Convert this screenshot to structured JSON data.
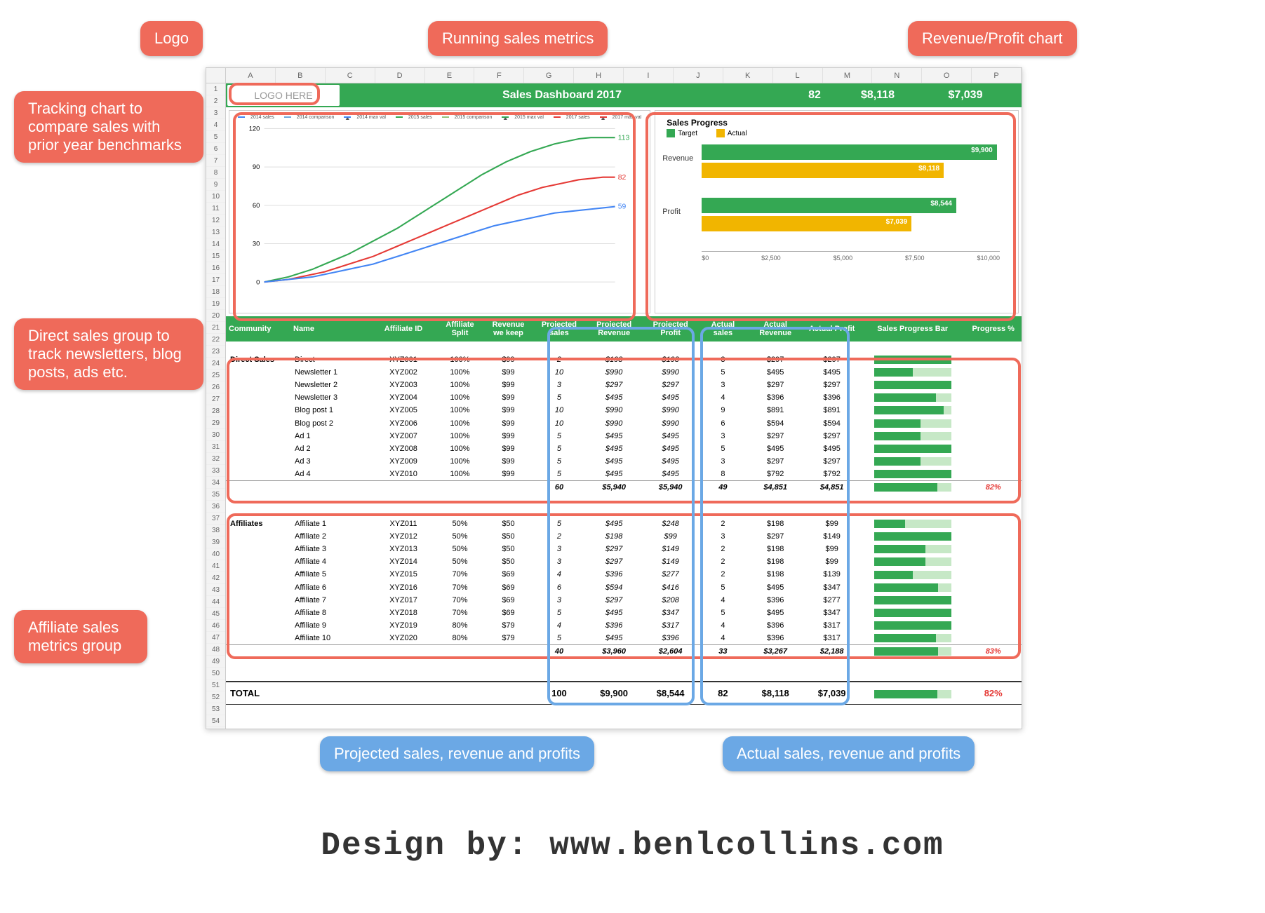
{
  "callouts": {
    "logo": "Logo",
    "running": "Running sales metrics",
    "revprofit": "Revenue/Profit chart",
    "tracking": "Tracking chart to compare sales with prior year benchmarks",
    "directgroup": "Direct sales  group to track newsletters, blog posts, ads etc.",
    "affgroup": "Affiliate sales metrics group",
    "projected": "Projected sales, revenue and profits",
    "actual": "Actual sales, revenue and profits"
  },
  "columns": [
    "A",
    "B",
    "C",
    "D",
    "E",
    "F",
    "G",
    "H",
    "I",
    "J",
    "K",
    "L",
    "M",
    "N",
    "O",
    "P"
  ],
  "row_numbers": [
    "1",
    "2",
    "3",
    "4",
    "5",
    "6",
    "7",
    "8",
    "9",
    "10",
    "11",
    "12",
    "13",
    "14",
    "15",
    "16",
    "17",
    "18",
    "19",
    "20",
    "21",
    "22",
    "23",
    "24",
    "25",
    "26",
    "27",
    "28",
    "29",
    "30",
    "31",
    "32",
    "33",
    "34",
    "35",
    "36",
    "37",
    "38",
    "39",
    "40",
    "41",
    "42",
    "43",
    "44",
    "45",
    "46",
    "47",
    "48",
    "49",
    "50",
    "51",
    "52",
    "53",
    "54"
  ],
  "title": {
    "logo": "LOGO HERE",
    "heading": "Sales Dashboard 2017",
    "metric1": "82",
    "metric2": "$8,118",
    "metric3": "$7,039"
  },
  "chart_data": [
    {
      "type": "line",
      "title": "",
      "ylim": [
        0,
        120
      ],
      "series_legend": [
        "2014 sales",
        "2014 comparison",
        "2014 max val",
        "2015 sales",
        "2015 comparison",
        "2015 max val",
        "2017 sales",
        "2017 max val"
      ],
      "end_labels": {
        "green": "113",
        "red": "82",
        "blue": "59"
      },
      "x": [
        0,
        2,
        4,
        6,
        8,
        10,
        12,
        14,
        16,
        18,
        20,
        22,
        24,
        26,
        28,
        30,
        32,
        34,
        36,
        38,
        40,
        42,
        44,
        46,
        48,
        50,
        52,
        54,
        56,
        58
      ],
      "series": [
        {
          "name": "2015 comparison",
          "color": "#34a853",
          "values": [
            0,
            2,
            4,
            7,
            10,
            14,
            18,
            22,
            27,
            32,
            37,
            42,
            48,
            54,
            60,
            66,
            72,
            78,
            84,
            89,
            94,
            98,
            102,
            105,
            108,
            110,
            112,
            113,
            113,
            113
          ]
        },
        {
          "name": "2017 sales",
          "color": "#e53935",
          "values": [
            0,
            1,
            2,
            4,
            6,
            8,
            11,
            14,
            17,
            20,
            24,
            28,
            32,
            36,
            40,
            44,
            48,
            52,
            56,
            60,
            64,
            68,
            71,
            74,
            76,
            78,
            80,
            81,
            82,
            82
          ]
        },
        {
          "name": "2014 sales",
          "color": "#4285f4",
          "values": [
            0,
            1,
            2,
            3,
            4,
            6,
            8,
            10,
            12,
            14,
            17,
            20,
            23,
            26,
            29,
            32,
            35,
            38,
            41,
            44,
            46,
            48,
            50,
            52,
            54,
            55,
            56,
            57,
            58,
            59
          ]
        }
      ]
    },
    {
      "type": "bar-horizontal",
      "title": "Sales Progress",
      "legend": [
        {
          "name": "Target",
          "color": "#34a853"
        },
        {
          "name": "Actual",
          "color": "#f1b500"
        }
      ],
      "categories": [
        "Revenue",
        "Profit"
      ],
      "series": [
        {
          "name": "Target",
          "values": [
            9900,
            8544
          ],
          "labels": [
            "$9,900",
            "$8,544"
          ]
        },
        {
          "name": "Actual",
          "values": [
            8118,
            7039
          ],
          "labels": [
            "$8,118",
            "$7,039"
          ]
        }
      ],
      "xticks": [
        "$0",
        "$2,500",
        "$5,000",
        "$7,500",
        "$10,000"
      ],
      "xmax": 10000
    }
  ],
  "table": {
    "headers": [
      "Community",
      "Name",
      "Affiliate ID",
      "Affiliate Split",
      "Revenue we keep",
      "Projected sales",
      "Projected Revenue",
      "Projected Profit",
      "Actual sales",
      "Actual Revenue",
      "Actual Profit",
      "Sales Progress Bar",
      "Progress %"
    ],
    "direct_label": "Direct Sales",
    "direct": [
      {
        "name": "Direct",
        "id": "XYZ001",
        "split": "100%",
        "keep": "$99",
        "ps": "2",
        "pr": "$198",
        "pp": "$198",
        "as": "3",
        "ar": "$297",
        "ap": "$297",
        "bar": 100
      },
      {
        "name": "Newsletter 1",
        "id": "XYZ002",
        "split": "100%",
        "keep": "$99",
        "ps": "10",
        "pr": "$990",
        "pp": "$990",
        "as": "5",
        "ar": "$495",
        "ap": "$495",
        "bar": 50
      },
      {
        "name": "Newsletter 2",
        "id": "XYZ003",
        "split": "100%",
        "keep": "$99",
        "ps": "3",
        "pr": "$297",
        "pp": "$297",
        "as": "3",
        "ar": "$297",
        "ap": "$297",
        "bar": 100
      },
      {
        "name": "Newsletter 3",
        "id": "XYZ004",
        "split": "100%",
        "keep": "$99",
        "ps": "5",
        "pr": "$495",
        "pp": "$495",
        "as": "4",
        "ar": "$396",
        "ap": "$396",
        "bar": 80
      },
      {
        "name": "Blog post 1",
        "id": "XYZ005",
        "split": "100%",
        "keep": "$99",
        "ps": "10",
        "pr": "$990",
        "pp": "$990",
        "as": "9",
        "ar": "$891",
        "ap": "$891",
        "bar": 90
      },
      {
        "name": "Blog post 2",
        "id": "XYZ006",
        "split": "100%",
        "keep": "$99",
        "ps": "10",
        "pr": "$990",
        "pp": "$990",
        "as": "6",
        "ar": "$594",
        "ap": "$594",
        "bar": 60
      },
      {
        "name": "Ad 1",
        "id": "XYZ007",
        "split": "100%",
        "keep": "$99",
        "ps": "5",
        "pr": "$495",
        "pp": "$495",
        "as": "3",
        "ar": "$297",
        "ap": "$297",
        "bar": 60
      },
      {
        "name": "Ad 2",
        "id": "XYZ008",
        "split": "100%",
        "keep": "$99",
        "ps": "5",
        "pr": "$495",
        "pp": "$495",
        "as": "5",
        "ar": "$495",
        "ap": "$495",
        "bar": 100
      },
      {
        "name": "Ad 3",
        "id": "XYZ009",
        "split": "100%",
        "keep": "$99",
        "ps": "5",
        "pr": "$495",
        "pp": "$495",
        "as": "3",
        "ar": "$297",
        "ap": "$297",
        "bar": 60
      },
      {
        "name": "Ad 4",
        "id": "XYZ010",
        "split": "100%",
        "keep": "$99",
        "ps": "5",
        "pr": "$495",
        "pp": "$495",
        "as": "8",
        "ar": "$792",
        "ap": "$792",
        "bar": 100
      }
    ],
    "direct_sub": {
      "ps": "60",
      "pr": "$5,940",
      "pp": "$5,940",
      "as": "49",
      "ar": "$4,851",
      "ap": "$4,851",
      "pct": "82%",
      "bar": 82
    },
    "aff_label": "Affiliates",
    "affiliates": [
      {
        "name": "Affiliate 1",
        "id": "XYZ011",
        "split": "50%",
        "keep": "$50",
        "ps": "5",
        "pr": "$495",
        "pp": "$248",
        "as": "2",
        "ar": "$198",
        "ap": "$99",
        "bar": 40
      },
      {
        "name": "Affiliate 2",
        "id": "XYZ012",
        "split": "50%",
        "keep": "$50",
        "ps": "2",
        "pr": "$198",
        "pp": "$99",
        "as": "3",
        "ar": "$297",
        "ap": "$149",
        "bar": 100
      },
      {
        "name": "Affiliate 3",
        "id": "XYZ013",
        "split": "50%",
        "keep": "$50",
        "ps": "3",
        "pr": "$297",
        "pp": "$149",
        "as": "2",
        "ar": "$198",
        "ap": "$99",
        "bar": 67
      },
      {
        "name": "Affiliate 4",
        "id": "XYZ014",
        "split": "50%",
        "keep": "$50",
        "ps": "3",
        "pr": "$297",
        "pp": "$149",
        "as": "2",
        "ar": "$198",
        "ap": "$99",
        "bar": 67
      },
      {
        "name": "Affiliate 5",
        "id": "XYZ015",
        "split": "70%",
        "keep": "$69",
        "ps": "4",
        "pr": "$396",
        "pp": "$277",
        "as": "2",
        "ar": "$198",
        "ap": "$139",
        "bar": 50
      },
      {
        "name": "Affiliate 6",
        "id": "XYZ016",
        "split": "70%",
        "keep": "$69",
        "ps": "6",
        "pr": "$594",
        "pp": "$416",
        "as": "5",
        "ar": "$495",
        "ap": "$347",
        "bar": 83
      },
      {
        "name": "Affiliate 7",
        "id": "XYZ017",
        "split": "70%",
        "keep": "$69",
        "ps": "3",
        "pr": "$297",
        "pp": "$208",
        "as": "4",
        "ar": "$396",
        "ap": "$277",
        "bar": 100
      },
      {
        "name": "Affiliate 8",
        "id": "XYZ018",
        "split": "70%",
        "keep": "$69",
        "ps": "5",
        "pr": "$495",
        "pp": "$347",
        "as": "5",
        "ar": "$495",
        "ap": "$347",
        "bar": 100
      },
      {
        "name": "Affiliate 9",
        "id": "XYZ019",
        "split": "80%",
        "keep": "$79",
        "ps": "4",
        "pr": "$396",
        "pp": "$317",
        "as": "4",
        "ar": "$396",
        "ap": "$317",
        "bar": 100
      },
      {
        "name": "Affiliate 10",
        "id": "XYZ020",
        "split": "80%",
        "keep": "$79",
        "ps": "5",
        "pr": "$495",
        "pp": "$396",
        "as": "4",
        "ar": "$396",
        "ap": "$317",
        "bar": 80
      }
    ],
    "aff_sub": {
      "ps": "40",
      "pr": "$3,960",
      "pp": "$2,604",
      "as": "33",
      "ar": "$3,267",
      "ap": "$2,188",
      "pct": "83%",
      "bar": 83
    },
    "total_label": "TOTAL",
    "total": {
      "ps": "100",
      "pr": "$9,900",
      "pp": "$8,544",
      "as": "82",
      "ar": "$8,118",
      "ap": "$7,039",
      "pct": "82%",
      "bar": 82
    }
  },
  "credit": "Design by: www.benlcollins.com"
}
